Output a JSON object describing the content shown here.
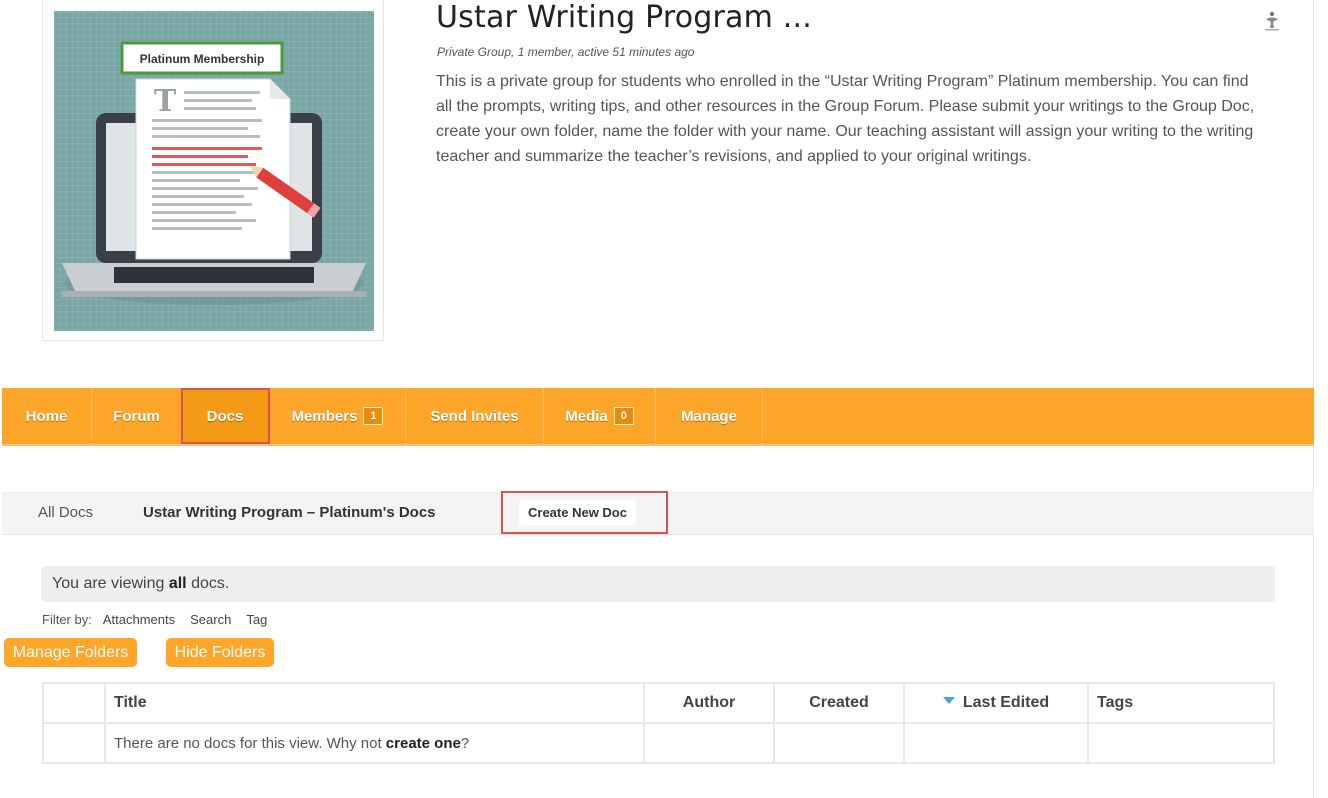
{
  "group": {
    "title": "Ustar Writing Program ...",
    "meta": "Private Group, 1 member, active 51 minutes ago",
    "description": "This is a private group for students who enrolled in the “Ustar Writing Program” Platinum membership. You can find all the prompts, writing tips, and other resources in the Group Forum. Please submit your writings to the Group Doc, create your own folder, name the folder with your name. Our teaching assistant will assign your writing to the writing teacher and summarize the teacher’s revisions, and applied to your original writings.",
    "avatar_label": "Platinum Membership",
    "avatar_letter": "T"
  },
  "nav": {
    "items": [
      {
        "label": "Home"
      },
      {
        "label": "Forum"
      },
      {
        "label": "Docs"
      },
      {
        "label": "Members",
        "badge": "1"
      },
      {
        "label": "Send Invites"
      },
      {
        "label": "Media",
        "badge": "0"
      },
      {
        "label": "Manage"
      }
    ],
    "active": "Docs"
  },
  "docs_nav": {
    "all_docs": "All Docs",
    "group_docs": "Ustar Writing Program – Platinum's Docs",
    "create_button": "Create New Doc"
  },
  "notice": {
    "prefix": "You are viewing ",
    "emphasis": "all",
    "suffix": " docs."
  },
  "filter": {
    "label": "Filter by:",
    "options": [
      "Attachments",
      "Search",
      "Tag"
    ]
  },
  "buttons": {
    "manage_folders": "Manage Folders",
    "hide_folders": "Hide Folders"
  },
  "table": {
    "columns": [
      "Title",
      "Author",
      "Created",
      "Last Edited",
      "Tags"
    ],
    "sorted_column": "Last Edited",
    "empty_prefix": "There are no docs for this view. Why not ",
    "empty_link": "create one",
    "empty_suffix": "?"
  },
  "colors": {
    "accent_orange": "#fea629",
    "highlight_red": "#d9534f",
    "sort_arrow_blue": "#4aa3d6"
  }
}
